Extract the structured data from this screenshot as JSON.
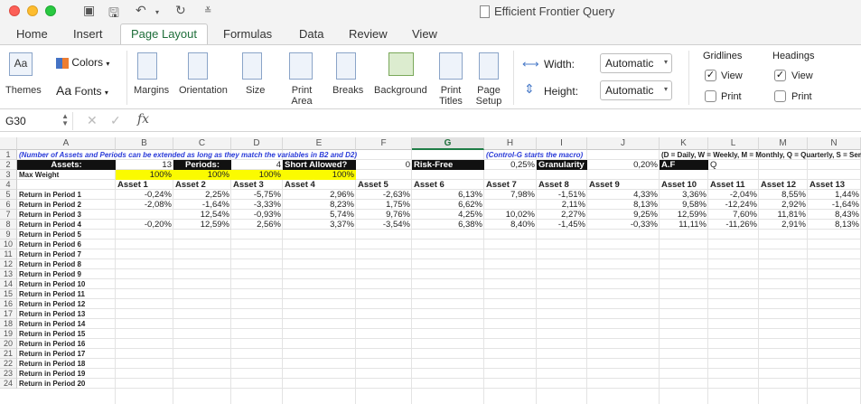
{
  "window": {
    "title": "Efficient Frontier Query"
  },
  "tabs": [
    "Home",
    "Insert",
    "Page Layout",
    "Formulas",
    "Data",
    "Review",
    "View"
  ],
  "ribbon": {
    "themes": "Themes",
    "colors": "Colors",
    "fonts": "Fonts",
    "margins": "Margins",
    "orientation": "Orientation",
    "size": "Size",
    "print_area": "Print Area",
    "breaks": "Breaks",
    "background": "Background",
    "print_titles": "Print Titles",
    "page_setup": "Page Setup",
    "width_label": "Width:",
    "width_value": "Automatic",
    "height_label": "Height:",
    "height_value": "Automatic",
    "gridlines": "Gridlines",
    "headings": "Headings",
    "view": "View",
    "print": "Print"
  },
  "formula_bar": {
    "name_box": "G30",
    "fx": "fx",
    "value": ""
  },
  "columns": [
    "A",
    "B",
    "C",
    "D",
    "E",
    "F",
    "G",
    "H",
    "I",
    "J",
    "K",
    "L",
    "M",
    "N"
  ],
  "selected_column": "G",
  "row_numbers": [
    "1",
    "2",
    "3",
    "4",
    "5",
    "6",
    "7",
    "8",
    "9",
    "10",
    "11",
    "12",
    "13",
    "14",
    "15",
    "16",
    "17",
    "18",
    "19",
    "20",
    "21",
    "22",
    "23",
    "24"
  ],
  "sheet": {
    "note_a1": "(Number of Assets and Periods can be extended as long as they match the variables in B2 and D2)",
    "note_h1": "(Control-G starts the macro)",
    "note_k1": "(D = Daily, W = Weekly, M = Monthly, Q = Quarterly, S = Sem",
    "assets_label": "Assets:",
    "assets_value": "13",
    "periods_label": "Periods:",
    "periods_value": "4",
    "short_label": "Short Allowed?",
    "short_value": "0",
    "riskfree_label": "Risk-Free",
    "riskfree_value": "0,25%",
    "granularity_label": "Granularity",
    "granularity_value": "0,20%",
    "af_label": "A.F",
    "af_value": "Q",
    "max_weight_label": "Max Weight",
    "max_weights": [
      "100%",
      "100%",
      "100%",
      "100%"
    ],
    "asset_headers": [
      "Asset 1",
      "Asset 2",
      "Asset 3",
      "Asset 4",
      "Asset 5",
      "Asset 6",
      "Asset 7",
      "Asset 8",
      "Asset 9",
      "Asset 10",
      "Asset 11",
      "Asset 12",
      "Asset 13"
    ],
    "period_labels": [
      "Return in Period 1",
      "Return in Period 2",
      "Return in Period 3",
      "Return in Period 4",
      "Return in Period 5",
      "Return in Period 6",
      "Return in Period 7",
      "Return in Period 8",
      "Return in Period 9",
      "Return in Period 10",
      "Return in Period 11",
      "Return in Period 12",
      "Return in Period 13",
      "Return in Period 14",
      "Return in Period 15",
      "Return in Period 16",
      "Return in Period 17",
      "Return in Period 18",
      "Return in Period 19",
      "Return in Period 20"
    ],
    "returns": [
      [
        "-0,24%",
        "2,25%",
        "-5,75%",
        "2,96%",
        "-2,63%",
        "6,13%",
        "7,98%",
        "-1,51%",
        "4,33%",
        "3,36%",
        "-2,04%",
        "8,55%",
        "1,44%"
      ],
      [
        "-2,08%",
        "-1,64%",
        "-3,33%",
        "8,23%",
        "1,75%",
        "6,62%",
        "",
        "2,11%",
        "8,13%",
        "9,58%",
        "-12,24%",
        "2,92%",
        "-1,64%"
      ],
      [
        "",
        "12,54%",
        "-0,93%",
        "5,74%",
        "9,76%",
        "4,25%",
        "10,02%",
        "2,27%",
        "9,25%",
        "12,59%",
        "7,60%",
        "11,81%",
        "8,43%"
      ],
      [
        "-0,20%",
        "12,59%",
        "2,56%",
        "3,37%",
        "-3,54%",
        "6,38%",
        "8,40%",
        "-1,45%",
        "-0,33%",
        "11,11%",
        "-11,26%",
        "2,91%",
        "8,13%"
      ]
    ]
  }
}
